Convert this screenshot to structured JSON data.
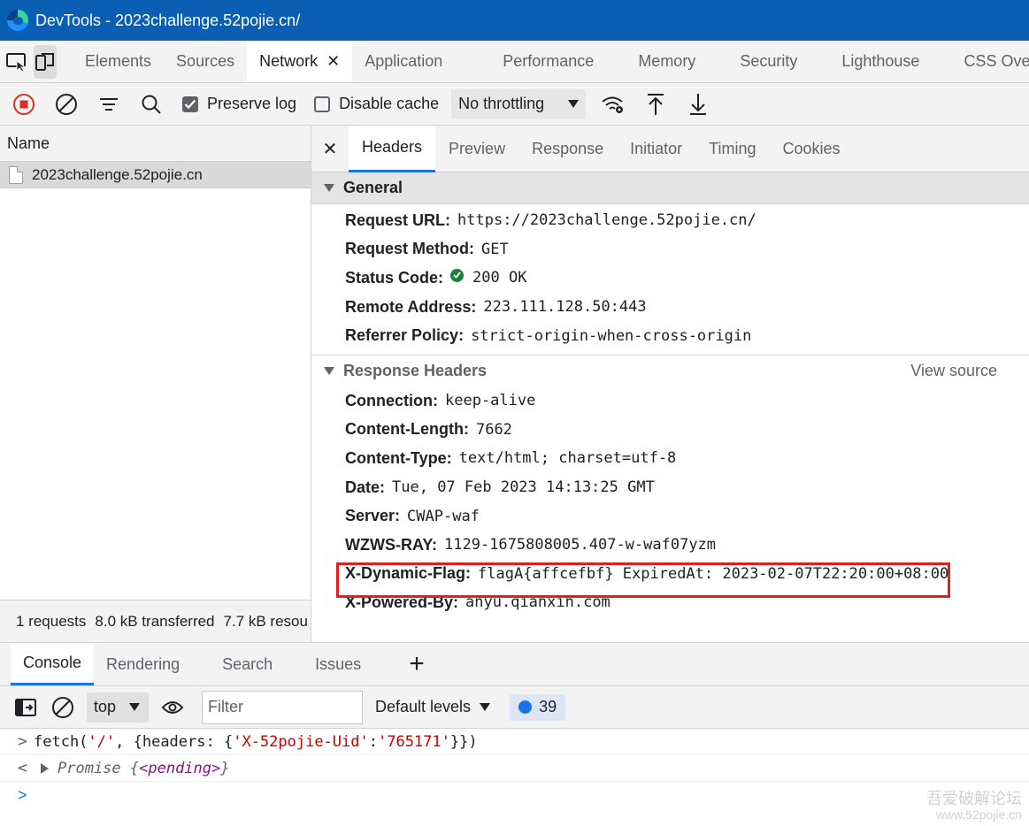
{
  "window": {
    "title": "DevTools - 2023challenge.52pojie.cn/"
  },
  "main_tabs": [
    "Elements",
    "Sources",
    "Network",
    "Application",
    "Performance",
    "Memory",
    "Security",
    "Lighthouse",
    "CSS Over"
  ],
  "network_toolbar": {
    "preserve_log": "Preserve log",
    "disable_cache": "Disable cache",
    "throttling": "No throttling"
  },
  "request_list": {
    "header": "Name",
    "requests": [
      "2023challenge.52pojie.cn"
    ],
    "summary": [
      "1 requests",
      "8.0 kB transferred",
      "7.7 kB resou"
    ]
  },
  "detail_tabs": [
    "Headers",
    "Preview",
    "Response",
    "Initiator",
    "Timing",
    "Cookies"
  ],
  "general": {
    "title": "General",
    "rows": [
      {
        "name": "Request URL:",
        "value": "https://2023challenge.52pojie.cn/"
      },
      {
        "name": "Request Method:",
        "value": "GET"
      },
      {
        "name": "Status Code:",
        "value": "200 OK"
      },
      {
        "name": "Remote Address:",
        "value": "223.111.128.50:443"
      },
      {
        "name": "Referrer Policy:",
        "value": "strict-origin-when-cross-origin"
      }
    ]
  },
  "response_headers": {
    "title": "Response Headers",
    "view_source": "View source",
    "rows": [
      {
        "name": "Connection:",
        "value": "keep-alive"
      },
      {
        "name": "Content-Length:",
        "value": "7662"
      },
      {
        "name": "Content-Type:",
        "value": "text/html; charset=utf-8"
      },
      {
        "name": "Date:",
        "value": "Tue, 07 Feb 2023 14:13:25 GMT"
      },
      {
        "name": "Server:",
        "value": "CWAP-waf"
      },
      {
        "name": "WZWS-RAY:",
        "value": "1129-1675808005.407-w-waf07yzm"
      },
      {
        "name": "X-Dynamic-Flag:",
        "value": "flagA{affcefbf} ExpiredAt: 2023-02-07T22:20:00+08:00"
      },
      {
        "name": "X-Powered-By:",
        "value": "anyu.qianxin.com"
      }
    ]
  },
  "drawer_tabs": [
    "Console",
    "Rendering",
    "Search",
    "Issues"
  ],
  "console_toolbar": {
    "context": "top",
    "filter_placeholder": "Filter",
    "levels": "Default levels",
    "message_count": "39"
  },
  "console": {
    "input_parts": [
      "fetch(",
      "'/'",
      ", {headers: {",
      "'X-52pojie-Uid'",
      ":",
      "'765171'",
      "}})"
    ],
    "result_prefix": "Promise {",
    "result_state": "<pending>",
    "result_suffix": "}"
  },
  "watermark": {
    "line1": "吾爱破解论坛",
    "line2": "www.52pojie.cn"
  },
  "colors": {
    "titlebar": "#0a5fb4",
    "highlight_box": "#e02020",
    "accent": "#1a73e8"
  }
}
